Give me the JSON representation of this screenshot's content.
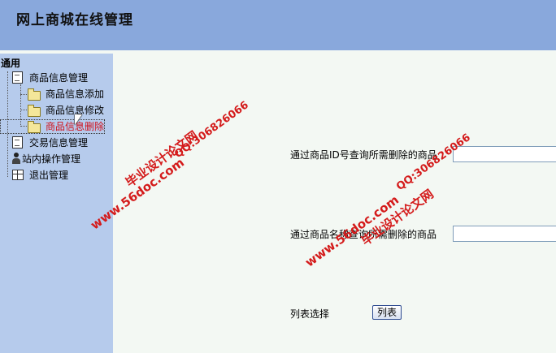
{
  "header": {
    "title": "网上商城在线管理"
  },
  "sidebar": {
    "root_label": "通用",
    "items": [
      {
        "label": "商品信息管理",
        "icon": "edit-doc-icon"
      },
      {
        "label": "商品信息添加",
        "icon": "folder-icon"
      },
      {
        "label": "商品信息修改",
        "icon": "folder-icon"
      },
      {
        "label": "商品信息删除",
        "icon": "folder-icon",
        "selected": true
      },
      {
        "label": "交易信息管理",
        "icon": "document-icon"
      },
      {
        "label": "站内操作管理",
        "icon": "user-icon"
      },
      {
        "label": "退出管理",
        "icon": "calendar-grid-icon"
      }
    ]
  },
  "main": {
    "by_id_label": "通过商品ID号查询所需删除的商品",
    "by_id_value": "",
    "by_name_label": "通过商品名称查询所需删除的商品",
    "by_name_value": "",
    "list_label": "列表选择",
    "list_button": "列表"
  },
  "watermarks": {
    "site": "www.56doc.com",
    "name": "毕业设计论文网",
    "qq": "QQ:306826066"
  },
  "colors": {
    "header_bg": "#89a8dc",
    "sidebar_bg": "#b6cbec",
    "content_bg": "#f3f8f3",
    "selected_text": "#d0101a",
    "watermark": "#d41b1b"
  }
}
